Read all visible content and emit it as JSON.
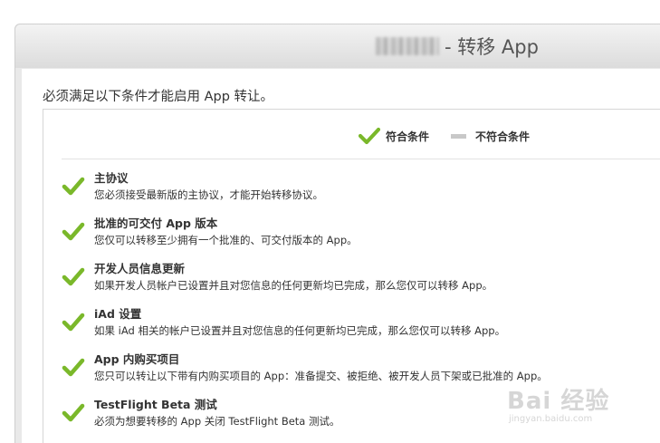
{
  "header": {
    "title": "- 转移 App"
  },
  "intro": "必须满足以下条件才能启用 App 转让。",
  "legend": {
    "met_label": "符合条件",
    "unmet_label": "不符合条件"
  },
  "requirements": [
    {
      "title": "主协议",
      "desc": "您必须接受最新版的主协议，才能开始转移协议。",
      "status": "met"
    },
    {
      "title": "批准的可交付 App 版本",
      "desc": "您仅可以转移至少拥有一个批准的、可交付版本的 App。",
      "status": "met"
    },
    {
      "title": "开发人员信息更新",
      "desc": "如果开发人员帐户已设置并且对您信息的任何更新均已完成，那么您仅可以转移 App。",
      "status": "met"
    },
    {
      "title": "iAd 设置",
      "desc": "如果 iAd 相关的帐户已设置并且对您信息的任何更新均已完成，那么您仅可以转移 App。",
      "status": "met"
    },
    {
      "title": "App 内购买项目",
      "desc": "您只可以转让以下带有内购买项目的 App：准备提交、被拒绝、被开发人员下架或已批准的 App。",
      "status": "met"
    },
    {
      "title": "TestFlight Beta 测试",
      "desc": "必须为想要转移的 App 关闭 TestFlight Beta 测试。",
      "status": "met"
    }
  ],
  "watermark": {
    "main": "Bai 经验",
    "sub": "jingyan.baidu.com"
  },
  "colors": {
    "check_green": "#7ab82a",
    "dash_gray": "#c8c8c8"
  }
}
